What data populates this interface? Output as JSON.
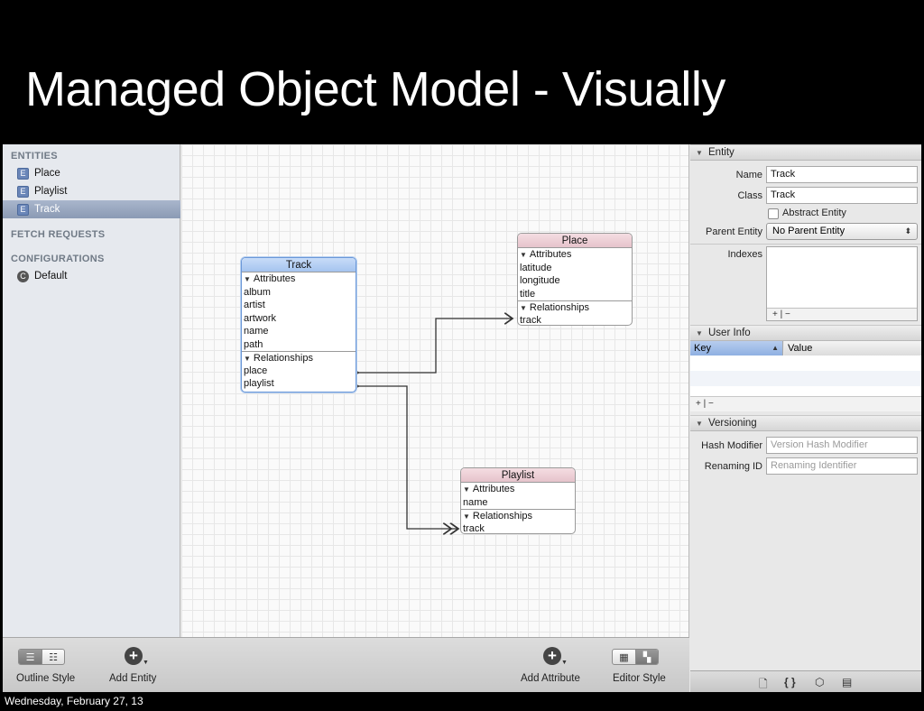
{
  "slide": {
    "title": "Managed Object Model - Visually",
    "footer_date": "Wednesday, February 27, 13"
  },
  "sidebar": {
    "entities_header": "ENTITIES",
    "entities": [
      {
        "badge": "E",
        "label": "Place",
        "selected": false
      },
      {
        "badge": "E",
        "label": "Playlist",
        "selected": false
      },
      {
        "badge": "E",
        "label": "Track",
        "selected": true
      }
    ],
    "fetch_requests_header": "FETCH REQUESTS",
    "configurations_header": "CONFIGURATIONS",
    "configurations": [
      {
        "badge": "C",
        "label": "Default"
      }
    ]
  },
  "canvas": {
    "track": {
      "title": "Track",
      "attributes_label": "Attributes",
      "attributes": [
        "album",
        "artist",
        "artwork",
        "name",
        "path"
      ],
      "relationships_label": "Relationships",
      "relationships": [
        "place",
        "playlist"
      ]
    },
    "place": {
      "title": "Place",
      "attributes_label": "Attributes",
      "attributes": [
        "latitude",
        "longitude",
        "title"
      ],
      "relationships_label": "Relationships",
      "relationships": [
        "track"
      ]
    },
    "playlist": {
      "title": "Playlist",
      "attributes_label": "Attributes",
      "attributes": [
        "name"
      ],
      "relationships_label": "Relationships",
      "relationships": [
        "track"
      ]
    }
  },
  "bottombar": {
    "outline_style": "Outline Style",
    "add_entity": "Add Entity",
    "add_attribute": "Add Attribute",
    "editor_style": "Editor Style"
  },
  "inspector": {
    "entity_header": "Entity",
    "name_label": "Name",
    "name_value": "Track",
    "class_label": "Class",
    "class_value": "Track",
    "abstract_label": "Abstract Entity",
    "parent_label": "Parent Entity",
    "parent_value": "No Parent Entity",
    "indexes_label": "Indexes",
    "indexes_footer": "+ | −",
    "user_info_header": "User Info",
    "key_col": "Key",
    "value_col": "Value",
    "user_info_footer": "+ | −",
    "versioning_header": "Versioning",
    "hash_label": "Hash Modifier",
    "hash_placeholder": "Version Hash Modifier",
    "renaming_label": "Renaming ID",
    "renaming_placeholder": "Renaming Identifier"
  },
  "colors": {
    "selected_entity_header": "#a5c4ef",
    "entity_header_pink": "#e6c3cb",
    "sidebar_selection": "#8b9ab4"
  }
}
